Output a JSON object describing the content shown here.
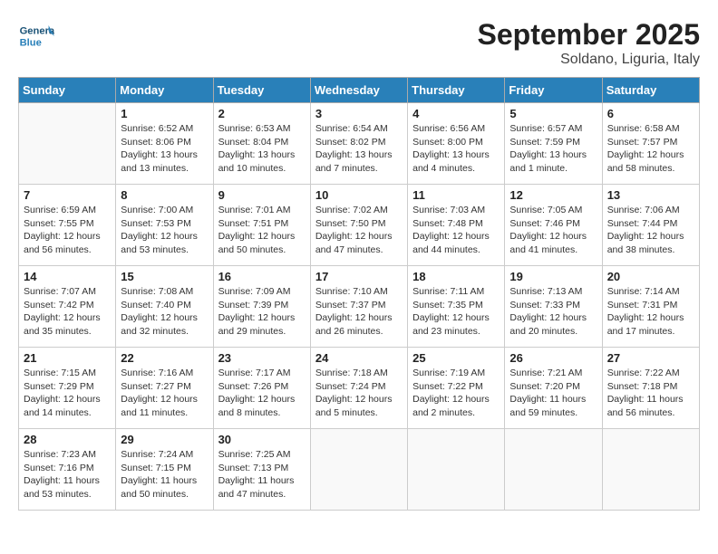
{
  "header": {
    "logo": {
      "general": "General",
      "blue": "Blue"
    },
    "title": "September 2025",
    "subtitle": "Soldano, Liguria, Italy"
  },
  "weekdays": [
    "Sunday",
    "Monday",
    "Tuesday",
    "Wednesday",
    "Thursday",
    "Friday",
    "Saturday"
  ],
  "weeks": [
    [
      {
        "day": "",
        "info": ""
      },
      {
        "day": "1",
        "info": "Sunrise: 6:52 AM\nSunset: 8:06 PM\nDaylight: 13 hours\nand 13 minutes."
      },
      {
        "day": "2",
        "info": "Sunrise: 6:53 AM\nSunset: 8:04 PM\nDaylight: 13 hours\nand 10 minutes."
      },
      {
        "day": "3",
        "info": "Sunrise: 6:54 AM\nSunset: 8:02 PM\nDaylight: 13 hours\nand 7 minutes."
      },
      {
        "day": "4",
        "info": "Sunrise: 6:56 AM\nSunset: 8:00 PM\nDaylight: 13 hours\nand 4 minutes."
      },
      {
        "day": "5",
        "info": "Sunrise: 6:57 AM\nSunset: 7:59 PM\nDaylight: 13 hours\nand 1 minute."
      },
      {
        "day": "6",
        "info": "Sunrise: 6:58 AM\nSunset: 7:57 PM\nDaylight: 12 hours\nand 58 minutes."
      }
    ],
    [
      {
        "day": "7",
        "info": "Sunrise: 6:59 AM\nSunset: 7:55 PM\nDaylight: 12 hours\nand 56 minutes."
      },
      {
        "day": "8",
        "info": "Sunrise: 7:00 AM\nSunset: 7:53 PM\nDaylight: 12 hours\nand 53 minutes."
      },
      {
        "day": "9",
        "info": "Sunrise: 7:01 AM\nSunset: 7:51 PM\nDaylight: 12 hours\nand 50 minutes."
      },
      {
        "day": "10",
        "info": "Sunrise: 7:02 AM\nSunset: 7:50 PM\nDaylight: 12 hours\nand 47 minutes."
      },
      {
        "day": "11",
        "info": "Sunrise: 7:03 AM\nSunset: 7:48 PM\nDaylight: 12 hours\nand 44 minutes."
      },
      {
        "day": "12",
        "info": "Sunrise: 7:05 AM\nSunset: 7:46 PM\nDaylight: 12 hours\nand 41 minutes."
      },
      {
        "day": "13",
        "info": "Sunrise: 7:06 AM\nSunset: 7:44 PM\nDaylight: 12 hours\nand 38 minutes."
      }
    ],
    [
      {
        "day": "14",
        "info": "Sunrise: 7:07 AM\nSunset: 7:42 PM\nDaylight: 12 hours\nand 35 minutes."
      },
      {
        "day": "15",
        "info": "Sunrise: 7:08 AM\nSunset: 7:40 PM\nDaylight: 12 hours\nand 32 minutes."
      },
      {
        "day": "16",
        "info": "Sunrise: 7:09 AM\nSunset: 7:39 PM\nDaylight: 12 hours\nand 29 minutes."
      },
      {
        "day": "17",
        "info": "Sunrise: 7:10 AM\nSunset: 7:37 PM\nDaylight: 12 hours\nand 26 minutes."
      },
      {
        "day": "18",
        "info": "Sunrise: 7:11 AM\nSunset: 7:35 PM\nDaylight: 12 hours\nand 23 minutes."
      },
      {
        "day": "19",
        "info": "Sunrise: 7:13 AM\nSunset: 7:33 PM\nDaylight: 12 hours\nand 20 minutes."
      },
      {
        "day": "20",
        "info": "Sunrise: 7:14 AM\nSunset: 7:31 PM\nDaylight: 12 hours\nand 17 minutes."
      }
    ],
    [
      {
        "day": "21",
        "info": "Sunrise: 7:15 AM\nSunset: 7:29 PM\nDaylight: 12 hours\nand 14 minutes."
      },
      {
        "day": "22",
        "info": "Sunrise: 7:16 AM\nSunset: 7:27 PM\nDaylight: 12 hours\nand 11 minutes."
      },
      {
        "day": "23",
        "info": "Sunrise: 7:17 AM\nSunset: 7:26 PM\nDaylight: 12 hours\nand 8 minutes."
      },
      {
        "day": "24",
        "info": "Sunrise: 7:18 AM\nSunset: 7:24 PM\nDaylight: 12 hours\nand 5 minutes."
      },
      {
        "day": "25",
        "info": "Sunrise: 7:19 AM\nSunset: 7:22 PM\nDaylight: 12 hours\nand 2 minutes."
      },
      {
        "day": "26",
        "info": "Sunrise: 7:21 AM\nSunset: 7:20 PM\nDaylight: 11 hours\nand 59 minutes."
      },
      {
        "day": "27",
        "info": "Sunrise: 7:22 AM\nSunset: 7:18 PM\nDaylight: 11 hours\nand 56 minutes."
      }
    ],
    [
      {
        "day": "28",
        "info": "Sunrise: 7:23 AM\nSunset: 7:16 PM\nDaylight: 11 hours\nand 53 minutes."
      },
      {
        "day": "29",
        "info": "Sunrise: 7:24 AM\nSunset: 7:15 PM\nDaylight: 11 hours\nand 50 minutes."
      },
      {
        "day": "30",
        "info": "Sunrise: 7:25 AM\nSunset: 7:13 PM\nDaylight: 11 hours\nand 47 minutes."
      },
      {
        "day": "",
        "info": ""
      },
      {
        "day": "",
        "info": ""
      },
      {
        "day": "",
        "info": ""
      },
      {
        "day": "",
        "info": ""
      }
    ]
  ]
}
